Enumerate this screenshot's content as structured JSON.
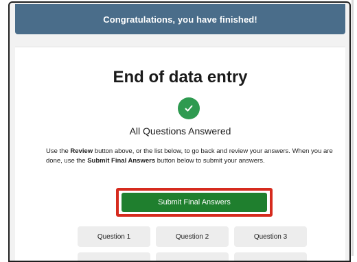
{
  "banner": {
    "text": "Congratulations, you have finished!"
  },
  "main": {
    "title": "End of data entry",
    "status": "All Questions Answered",
    "instructions": {
      "part1": "Use the ",
      "review_bold": "Review",
      "part2": " button above, or the list below, to go back and review your answers. When you are done, use the ",
      "submit_bold": "Submit Final Answers",
      "part3": " button below to submit your answers."
    },
    "submit_label": "Submit Final Answers",
    "questions": [
      "Question 1",
      "Question 2",
      "Question 3"
    ]
  },
  "icons": {
    "status": "check-circle-icon"
  },
  "colors": {
    "banner": "#4a6d8a",
    "check": "#2e9a50",
    "submit": "#1f7f2e",
    "highlight": "#d62b1e"
  }
}
